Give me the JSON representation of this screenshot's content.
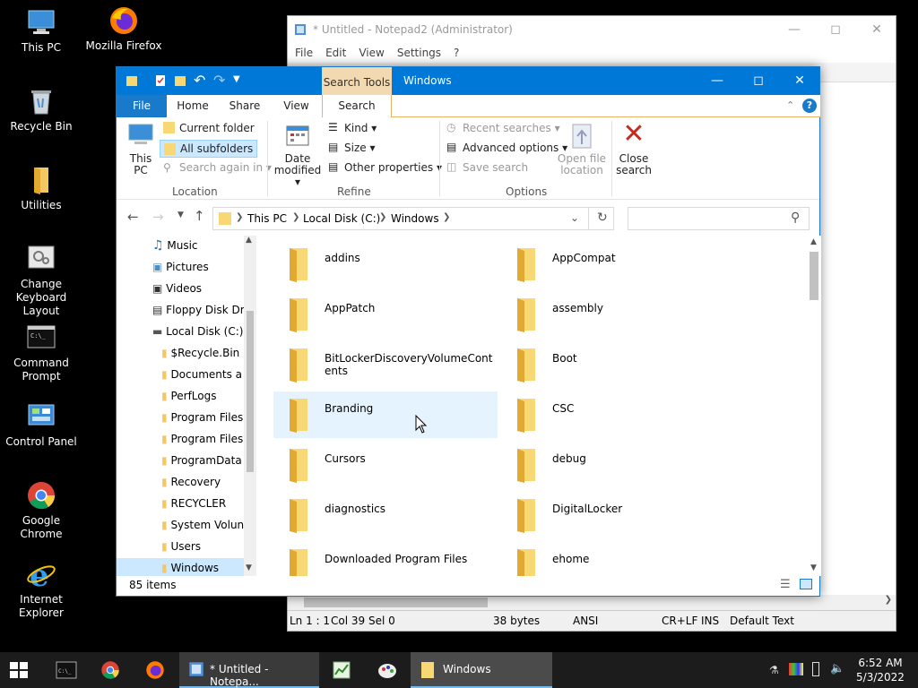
{
  "desktop": {
    "icons": [
      {
        "label": "This PC"
      },
      {
        "label": "Mozilla Firefox"
      },
      {
        "label": "Recycle Bin"
      },
      {
        "label": "Utilities"
      },
      {
        "label": "Change Keyboard Layout"
      },
      {
        "label": "Command Prompt"
      },
      {
        "label": "Control Panel"
      },
      {
        "label": "Google Chrome"
      },
      {
        "label": "Internet Explorer"
      }
    ]
  },
  "notepad": {
    "title": "* Untitled - Notepad2 (Administrator)",
    "menu": [
      "File",
      "Edit",
      "View",
      "Settings",
      "?"
    ],
    "status": {
      "position": "Ln 1 : 1",
      "col": "Col 39",
      "sel": "Sel 0",
      "size": "38 bytes",
      "encoding": "ANSI",
      "eol": "CR+LF",
      "mode": "INS",
      "scheme": "Default Text"
    }
  },
  "explorer": {
    "context_tab": "Search Tools",
    "title": "Windows",
    "tabs": [
      "File",
      "Home",
      "Share",
      "View",
      "Search"
    ],
    "ribbon": {
      "this_pc": "This PC",
      "current_folder": "Current folder",
      "all_subfolders": "All subfolders",
      "search_again": "Search again in",
      "location_group": "Location",
      "date_modified": "Date modified",
      "kind": "Kind",
      "size": "Size",
      "other_properties": "Other properties",
      "refine_group": "Refine",
      "recent_searches": "Recent searches",
      "advanced_options": "Advanced options",
      "save_search": "Save search",
      "open_file_location": "Open file location",
      "close_search": "Close search",
      "options_group": "Options"
    },
    "breadcrumb": [
      "This PC",
      "Local Disk (C:)",
      "Windows"
    ],
    "search_placeholder": "",
    "nav": [
      "Music",
      "Pictures",
      "Videos",
      "Floppy Disk Dri",
      "Local Disk (C:)",
      "$Recycle.Bin",
      "Documents a",
      "PerfLogs",
      "Program Files",
      "Program Files",
      "ProgramData",
      "Recovery",
      "RECYCLER",
      "System Volun",
      "Users",
      "Windows"
    ],
    "files": [
      "addins",
      "AppCompat",
      "AppPatch",
      "assembly",
      "BitLockerDiscoveryVolumeContents",
      "Boot",
      "Branding",
      "CSC",
      "Cursors",
      "debug",
      "diagnostics",
      "DigitalLocker",
      "Downloaded Program Files",
      "ehome"
    ],
    "item_count": "85 items"
  },
  "taskbar": {
    "notepad_label": "* Untitled - Notepa...",
    "explorer_label": "Windows",
    "time": "6:52 AM",
    "date": "5/3/2022"
  }
}
